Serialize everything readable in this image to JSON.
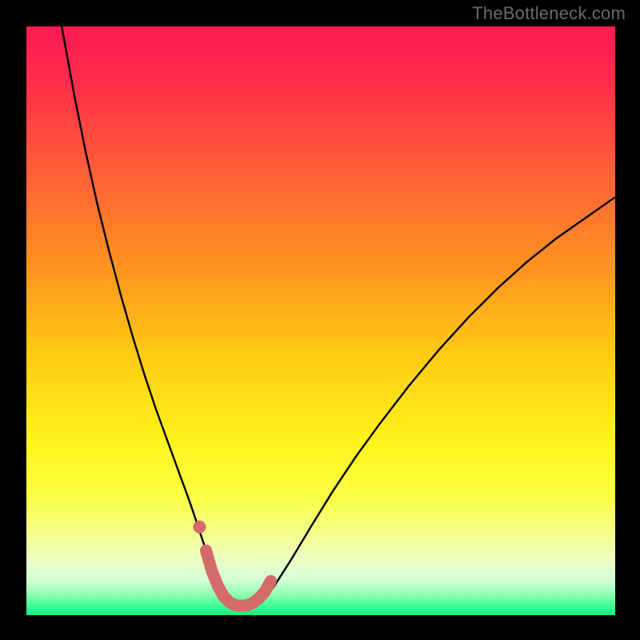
{
  "watermark": "TheBottleneck.com",
  "chart_data": {
    "type": "line",
    "title": "",
    "xlabel": "",
    "ylabel": "",
    "xlim": [
      0,
      100
    ],
    "ylim": [
      0,
      100
    ],
    "background_gradient": {
      "stops": [
        {
          "offset": 0.0,
          "color": "#ff1a54"
        },
        {
          "offset": 0.1,
          "color": "#ff2e4a"
        },
        {
          "offset": 0.25,
          "color": "#ff6038"
        },
        {
          "offset": 0.4,
          "color": "#ff9020"
        },
        {
          "offset": 0.55,
          "color": "#ffc814"
        },
        {
          "offset": 0.7,
          "color": "#fff21a"
        },
        {
          "offset": 0.8,
          "color": "#fbff46"
        },
        {
          "offset": 0.86,
          "color": "#f4ff8a"
        },
        {
          "offset": 0.905,
          "color": "#ecffc4"
        },
        {
          "offset": 0.94,
          "color": "#d4ffd6"
        },
        {
          "offset": 0.965,
          "color": "#90ffb0"
        },
        {
          "offset": 0.985,
          "color": "#3aff96"
        },
        {
          "offset": 1.0,
          "color": "#18e87e"
        }
      ]
    },
    "series": [
      {
        "name": "bottleneck-curve",
        "color": "#000000",
        "width": 2.4,
        "x": [
          6.0,
          8.0,
          10.0,
          12.0,
          14.0,
          16.0,
          18.0,
          20.0,
          22.0,
          24.0,
          26.0,
          27.0,
          28.0,
          29.0,
          30.0,
          31.0,
          32.0,
          33.0,
          34.0,
          35.0,
          36.0,
          37.0,
          38.0,
          40.0,
          42.0,
          45.0,
          48.0,
          52.0,
          56.0,
          60.0,
          65.0,
          70.0,
          75.0,
          80.0,
          85.0,
          90.0,
          95.0,
          100.0
        ],
        "y": [
          100.0,
          89.0,
          79.0,
          70.0,
          62.0,
          54.5,
          47.5,
          41.0,
          35.0,
          29.5,
          24.0,
          21.3,
          18.5,
          15.5,
          12.5,
          9.5,
          6.5,
          4.0,
          2.3,
          1.4,
          1.0,
          1.0,
          1.2,
          2.3,
          4.8,
          9.5,
          14.5,
          21.0,
          27.0,
          32.5,
          39.0,
          45.0,
          50.5,
          55.5,
          60.0,
          64.0,
          67.5,
          71.0
        ]
      },
      {
        "name": "optimal-band-marker",
        "color": "#d46a6a",
        "width": 15,
        "linecap": "round",
        "x": [
          30.5,
          31.5,
          32.5,
          33.5,
          34.5,
          35.5,
          36.5,
          37.5,
          38.5,
          39.5,
          40.5,
          41.5
        ],
        "y": [
          11.0,
          7.5,
          5.0,
          3.2,
          2.2,
          1.7,
          1.6,
          1.7,
          2.1,
          2.9,
          4.0,
          5.8
        ]
      },
      {
        "name": "optimal-dot",
        "type_hint": "scatter",
        "color": "#d46a6a",
        "radius": 8,
        "x": [
          29.4
        ],
        "y": [
          15.0
        ]
      }
    ]
  }
}
